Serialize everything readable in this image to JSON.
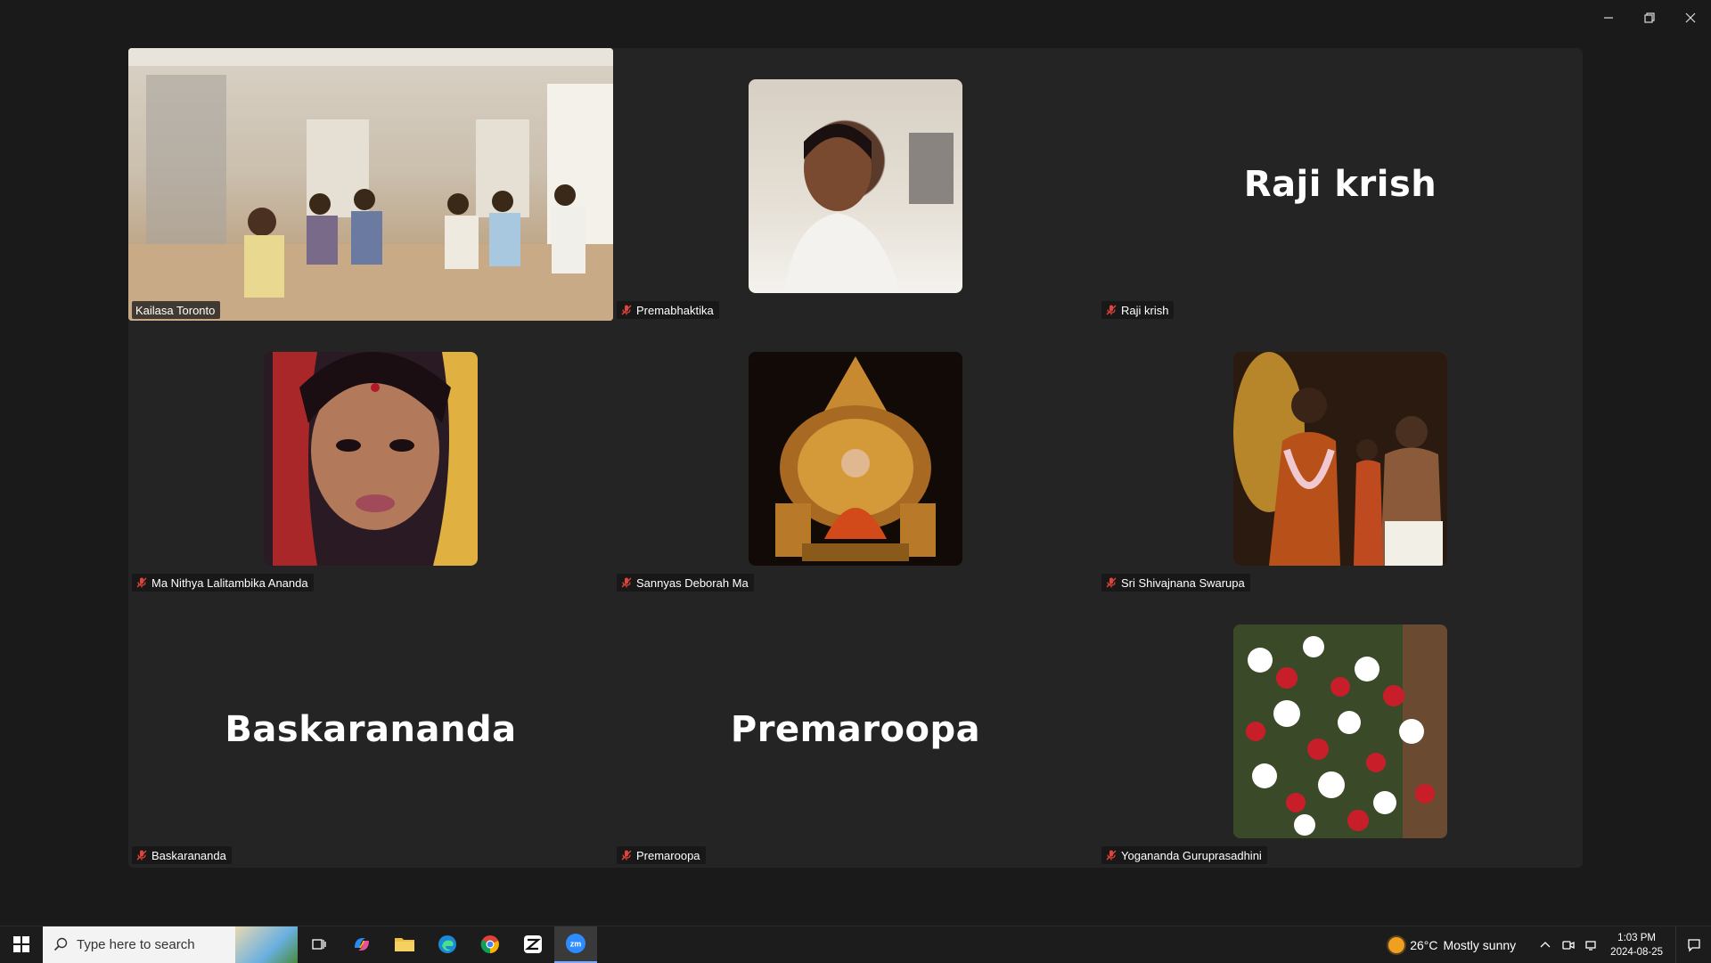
{
  "window_controls": {
    "minimize": "minimize",
    "restore": "restore",
    "close": "close"
  },
  "participants": [
    {
      "id": "kailasa-toronto",
      "name": "Kailasa Toronto",
      "kind": "video",
      "active_speaker": true,
      "muted": false
    },
    {
      "id": "premabhaktika",
      "name": "Premabhaktika",
      "kind": "photo",
      "muted": true
    },
    {
      "id": "raji-krish",
      "name": "Raji krish",
      "kind": "name",
      "display_name": "Raji krish",
      "muted": true
    },
    {
      "id": "ma-nithya",
      "name": "Ma Nithya Lalitambika Ananda",
      "kind": "photo",
      "muted": true
    },
    {
      "id": "sannyas-deborah",
      "name": "Sannyas Deborah Ma",
      "kind": "photo",
      "muted": true
    },
    {
      "id": "sri-shivajnana",
      "name": "Sri Shivajnana Swarupa",
      "kind": "photo",
      "muted": true
    },
    {
      "id": "baskarananda",
      "name": "Baskarananda",
      "kind": "name",
      "display_name": "Baskarananda",
      "muted": true
    },
    {
      "id": "premaroopa",
      "name": "Premaroopa",
      "kind": "name",
      "display_name": "Premaroopa",
      "muted": true
    },
    {
      "id": "yogananda",
      "name": "Yogananda Guruprasadhini",
      "kind": "photo",
      "muted": true
    }
  ],
  "taskbar": {
    "search_placeholder": "Type here to search",
    "apps": [
      "task-view-icon",
      "copilot-icon",
      "file-explorer-icon",
      "edge-icon",
      "chrome-icon",
      "capcut-icon",
      "zoom-icon"
    ],
    "weather": {
      "temp": "26°C",
      "condition": "Mostly sunny"
    },
    "clock": {
      "time": "1:03 PM",
      "date": "2024-08-25"
    }
  },
  "colors": {
    "active_border": "#2ccf86",
    "mute_red": "#e0453a",
    "grid_bg": "#242424"
  }
}
